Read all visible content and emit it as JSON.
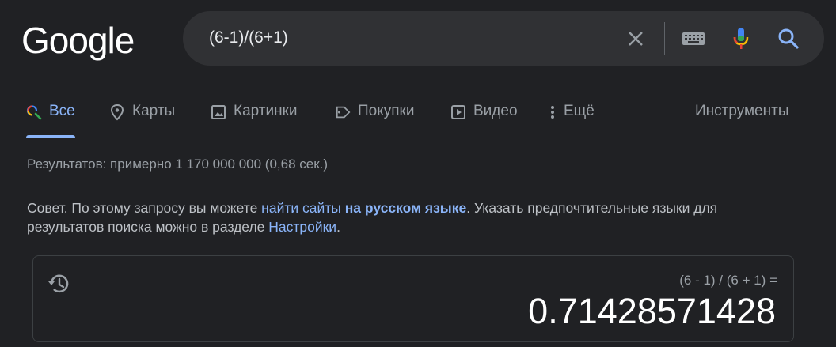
{
  "logo": {
    "text": "Google"
  },
  "search": {
    "query": "(6-1)/(6+1)"
  },
  "icons": {
    "clear": "close-icon",
    "keyboard": "keyboard-icon",
    "mic": "microphone-icon",
    "search": "search-icon",
    "history": "history-icon"
  },
  "tabs": [
    {
      "label": "Все",
      "icon": "search-icon",
      "active": true
    },
    {
      "label": "Карты",
      "icon": "map-pin-icon"
    },
    {
      "label": "Картинки",
      "icon": "image-icon"
    },
    {
      "label": "Покупки",
      "icon": "tag-icon"
    },
    {
      "label": "Видео",
      "icon": "play-icon"
    },
    {
      "label": "Ещё",
      "icon": "more-vert-icon"
    }
  ],
  "tools": {
    "label": "Инструменты"
  },
  "results": {
    "stats": "Результатов: примерно 1 170 000 000 (0,68 сек.)"
  },
  "tip": {
    "prefix": "Совет. По этому запросу вы можете ",
    "link1": "найти сайты ",
    "link1_bold": "на русском языке",
    "middle": ". Указать предпочтительные языки для результатов поиска можно в разделе ",
    "link2": "Настройки",
    "suffix": "."
  },
  "calculator": {
    "expression": "(6 - 1) / (6 + 1) =",
    "result": "0.71428571428"
  },
  "colors": {
    "background": "#202124",
    "accent": "#8ab4f8",
    "searchbar": "#303134"
  }
}
